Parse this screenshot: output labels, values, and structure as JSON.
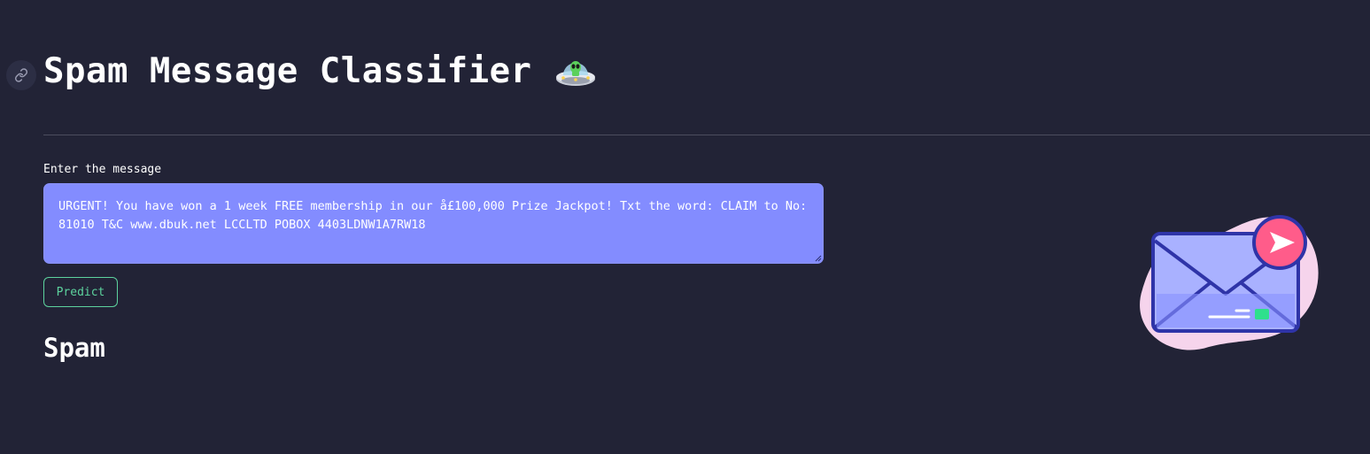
{
  "header": {
    "title": "Spam Message Classifier",
    "title_emoji": "ufo-with-alien"
  },
  "form": {
    "label": "Enter the message",
    "message": "URGENT! You have won a 1 week FREE membership in our å£100,000 Prize Jackpot! Txt the word: CLAIM to No: 81010 T&C www.dbuk.net LCCLTD POBOX 4403LDNW1A7RW18",
    "predict_label": "Predict"
  },
  "result": {
    "prediction": "Spam"
  },
  "illustration": {
    "name": "envelope-send-icon"
  },
  "colors": {
    "background": "#222336",
    "textarea": "#838cff",
    "button_accent": "#5dd39e",
    "text": "#ffffff"
  }
}
